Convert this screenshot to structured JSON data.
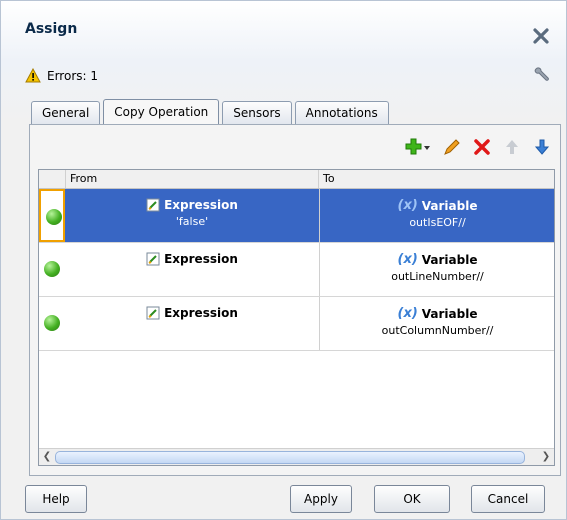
{
  "dialog": {
    "title": "Assign",
    "errors_label": "Errors: 1"
  },
  "tabs": [
    {
      "label": "General",
      "active": false
    },
    {
      "label": "Copy Operation",
      "active": true
    },
    {
      "label": "Sensors",
      "active": false
    },
    {
      "label": "Annotations",
      "active": false
    }
  ],
  "toolbar": {
    "icons": [
      "add-icon",
      "edit-icon",
      "delete-icon",
      "move-up-icon",
      "move-down-icon"
    ]
  },
  "grid": {
    "headers": {
      "from": "From",
      "to": "To"
    },
    "rows": [
      {
        "from_type": "Expression",
        "from_value": "'false'",
        "to_icon": "(x)",
        "to_type": "Variable",
        "to_value": "outIsEOF//",
        "selected": true
      },
      {
        "from_type": "Expression",
        "from_value": "",
        "to_icon": "(x)",
        "to_type": "Variable",
        "to_value": "outLineNumber//",
        "selected": false
      },
      {
        "from_type": "Expression",
        "from_value": "",
        "to_icon": "(x)",
        "to_type": "Variable",
        "to_value": "outColumnNumber//",
        "selected": false
      }
    ]
  },
  "buttons": {
    "help": "Help",
    "apply": "Apply",
    "ok": "OK",
    "cancel": "Cancel"
  },
  "colors": {
    "selection": "#3866c4",
    "status_ok": "#44b022",
    "accent": "#3a7fd5"
  }
}
